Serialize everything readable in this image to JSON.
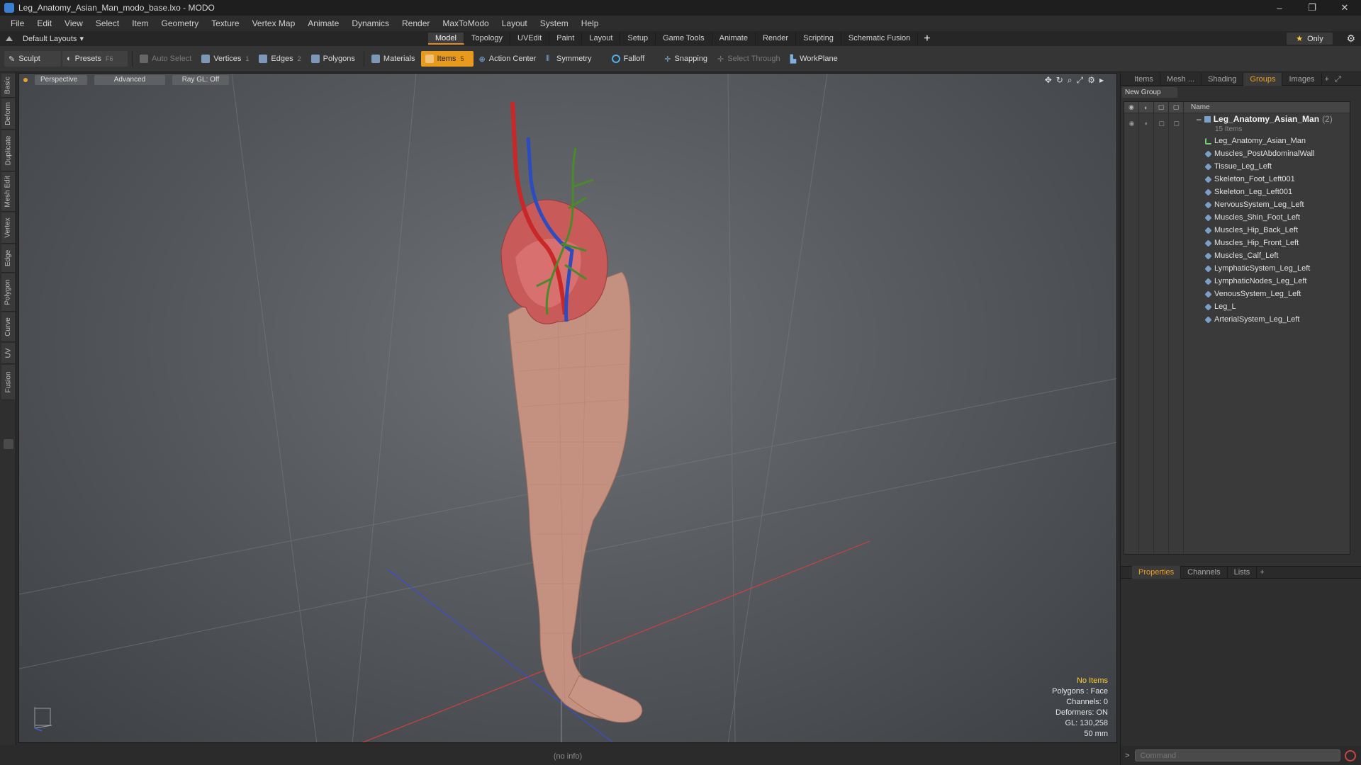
{
  "window": {
    "title": "Leg_Anatomy_Asian_Man_modo_base.lxo - MODO",
    "controls": [
      "–",
      "❐",
      "✕"
    ]
  },
  "menu": [
    "File",
    "Edit",
    "View",
    "Select",
    "Item",
    "Geometry",
    "Texture",
    "Vertex Map",
    "Animate",
    "Dynamics",
    "Render",
    "MaxToModo",
    "Layout",
    "System",
    "Help"
  ],
  "layout": {
    "selector": "Default Layouts",
    "tabs": [
      "Model",
      "Topology",
      "UVEdit",
      "Paint",
      "Layout",
      "Setup",
      "Game Tools",
      "Animate",
      "Render",
      "Scripting",
      "Schematic Fusion"
    ],
    "active_tab": "Model",
    "plus": "+",
    "only_label": "Only",
    "only_star": "★"
  },
  "toolbar": {
    "sculpt": "Sculpt",
    "presets": "Presets",
    "presets_key": "F6",
    "auto_select": "Auto Select",
    "vertices": "Vertices",
    "vertices_key": "1",
    "edges": "Edges",
    "edges_key": "2",
    "polygons": "Polygons",
    "materials": "Materials",
    "items": "Items",
    "items_key": "5",
    "action_center": "Action Center",
    "symmetry": "Symmetry",
    "falloff": "Falloff",
    "snapping": "Snapping",
    "select_through": "Select Through",
    "workplane": "WorkPlane"
  },
  "left_tabs": [
    "Basic",
    "Deform",
    "Duplicate",
    "Mesh Edit",
    "Vertex",
    "Edge",
    "Polygon",
    "Curve",
    "UV",
    "Fusion"
  ],
  "viewport": {
    "view": "Perspective",
    "shading": "Advanced",
    "raygl": "Ray GL: Off",
    "info": {
      "selection": "No Items",
      "polygons": "Polygons : Face",
      "channels": "Channels: 0",
      "deformers": "Deformers: ON",
      "gl": "GL: 130,258",
      "focal": "50 mm"
    }
  },
  "status": "(no info)",
  "right_panel": {
    "tabs": [
      "Items",
      "Mesh ...",
      "Shading",
      "Groups",
      "Images"
    ],
    "active_tab": "Groups",
    "new_group": "New Group",
    "name_header": "Name",
    "group": {
      "name": "Leg_Anatomy_Asian_Man",
      "count": "(2)",
      "items_label": "15 Items"
    },
    "items": [
      {
        "label": "Leg_Anatomy_Asian_Man",
        "kind": "locator"
      },
      {
        "label": "Muscles_PostAbdominalWall",
        "kind": "mesh"
      },
      {
        "label": "Tissue_Leg_Left",
        "kind": "mesh"
      },
      {
        "label": "Skeleton_Foot_Left001",
        "kind": "mesh"
      },
      {
        "label": "Skeleton_Leg_Left001",
        "kind": "mesh"
      },
      {
        "label": "NervousSystem_Leg_Left",
        "kind": "mesh"
      },
      {
        "label": "Muscles_Shin_Foot_Left",
        "kind": "mesh"
      },
      {
        "label": "Muscles_Hip_Back_Left",
        "kind": "mesh"
      },
      {
        "label": "Muscles_Hip_Front_Left",
        "kind": "mesh"
      },
      {
        "label": "Muscles_Calf_Left",
        "kind": "mesh"
      },
      {
        "label": "LymphaticSystem_Leg_Left",
        "kind": "mesh"
      },
      {
        "label": "LymphaticNodes_Leg_Left",
        "kind": "mesh"
      },
      {
        "label": "VenousSystem_Leg_Left",
        "kind": "mesh"
      },
      {
        "label": "Leg_L",
        "kind": "mesh"
      },
      {
        "label": "ArterialSystem_Leg_Left",
        "kind": "mesh"
      }
    ],
    "prop_tabs": [
      "Properties",
      "Channels",
      "Lists"
    ],
    "prop_active": "Properties",
    "command_placeholder": "Command"
  },
  "colors": {
    "accent": "#e89a1e",
    "skin": "#c49080",
    "muscle": "#c85a5a",
    "artery": "#c82828",
    "vein": "#2c4cc0",
    "nerve": "#4a8a2a"
  }
}
